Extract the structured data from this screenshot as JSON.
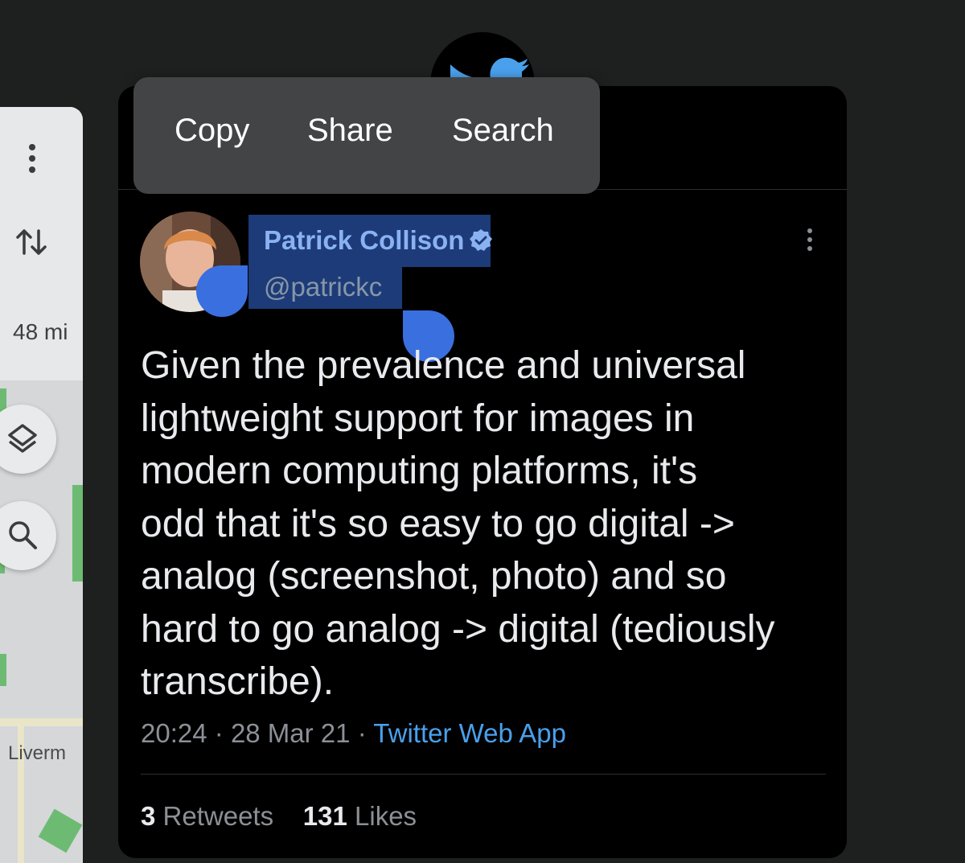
{
  "context_menu": {
    "items": [
      {
        "label": "Copy"
      },
      {
        "label": "Share"
      },
      {
        "label": "Search"
      }
    ]
  },
  "maps": {
    "distance": "48 mi",
    "city": "Liverm"
  },
  "tweet": {
    "author_name": "Patrick Collison",
    "author_handle": "@patrickc",
    "text_lines": [
      "Given the prevalence and universal",
      "lightweight support for images in",
      "modern computing platforms, it's",
      "odd that it's so easy to go digital ->",
      "analog (screenshot, photo) and so",
      "hard to go analog -> digital (tediously",
      "transcribe)."
    ],
    "time": "20:24",
    "date": "28 Mar 21",
    "separator": "·",
    "source": "Twitter Web App",
    "retweets_count": "3",
    "retweets_label": "Retweets",
    "likes_count": "131",
    "likes_label": "Likes"
  },
  "colors": {
    "twitter_blue": "#4aa0ec",
    "selection": "#1d3b78",
    "selection_handle": "#3a6fe0"
  }
}
